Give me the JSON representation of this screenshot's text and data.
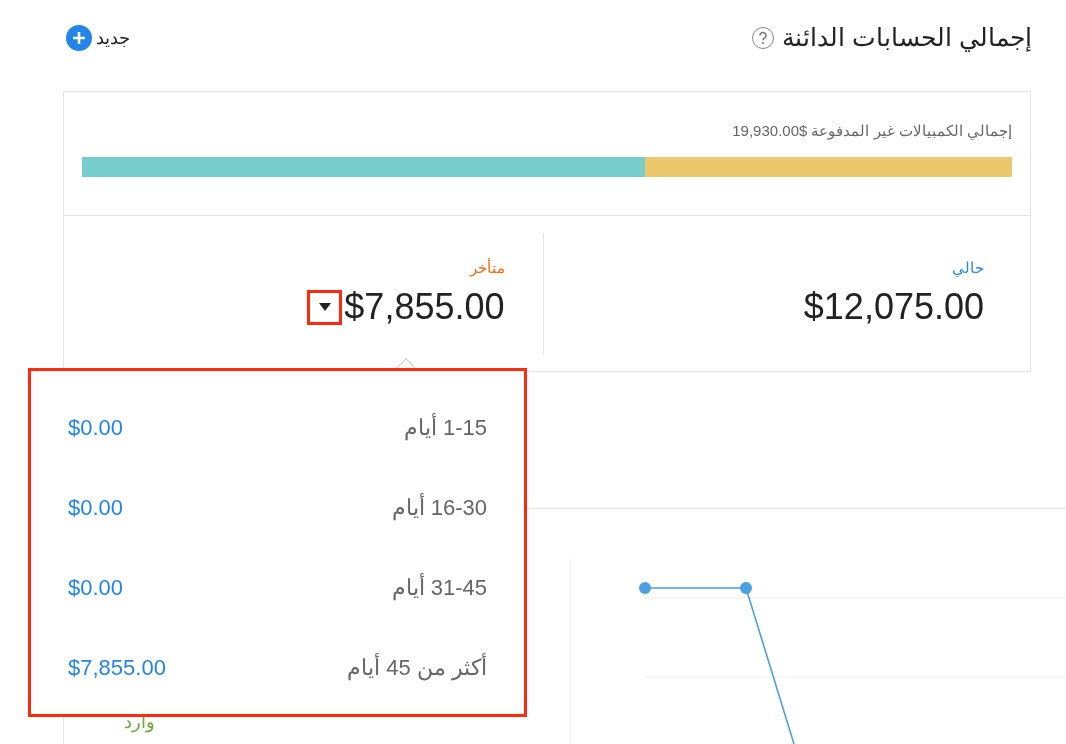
{
  "header": {
    "title": "إجمالي الحسابات الدائنة",
    "new_button": "جديد"
  },
  "summary": {
    "label": "إجمالي الكمبيالات غير المدفوعة $19,930.00",
    "level": 0.605
  },
  "columns": [
    {
      "label": "حالي",
      "amount": "$12,075.00",
      "kind": "current"
    },
    {
      "label": "متأخر",
      "amount": "$7,855.00",
      "kind": "overdue"
    }
  ],
  "overdue_breakdown": [
    {
      "range": "1-15 أيام",
      "amount": "$0.00"
    },
    {
      "range": "16-30 أيام",
      "amount": "$0.00"
    },
    {
      "range": "31-45 أيام",
      "amount": "$0.00"
    },
    {
      "range": "أكثر من 45 أيام",
      "amount": "$7,855.00"
    }
  ],
  "lower_card": {
    "label": "وارد"
  }
}
